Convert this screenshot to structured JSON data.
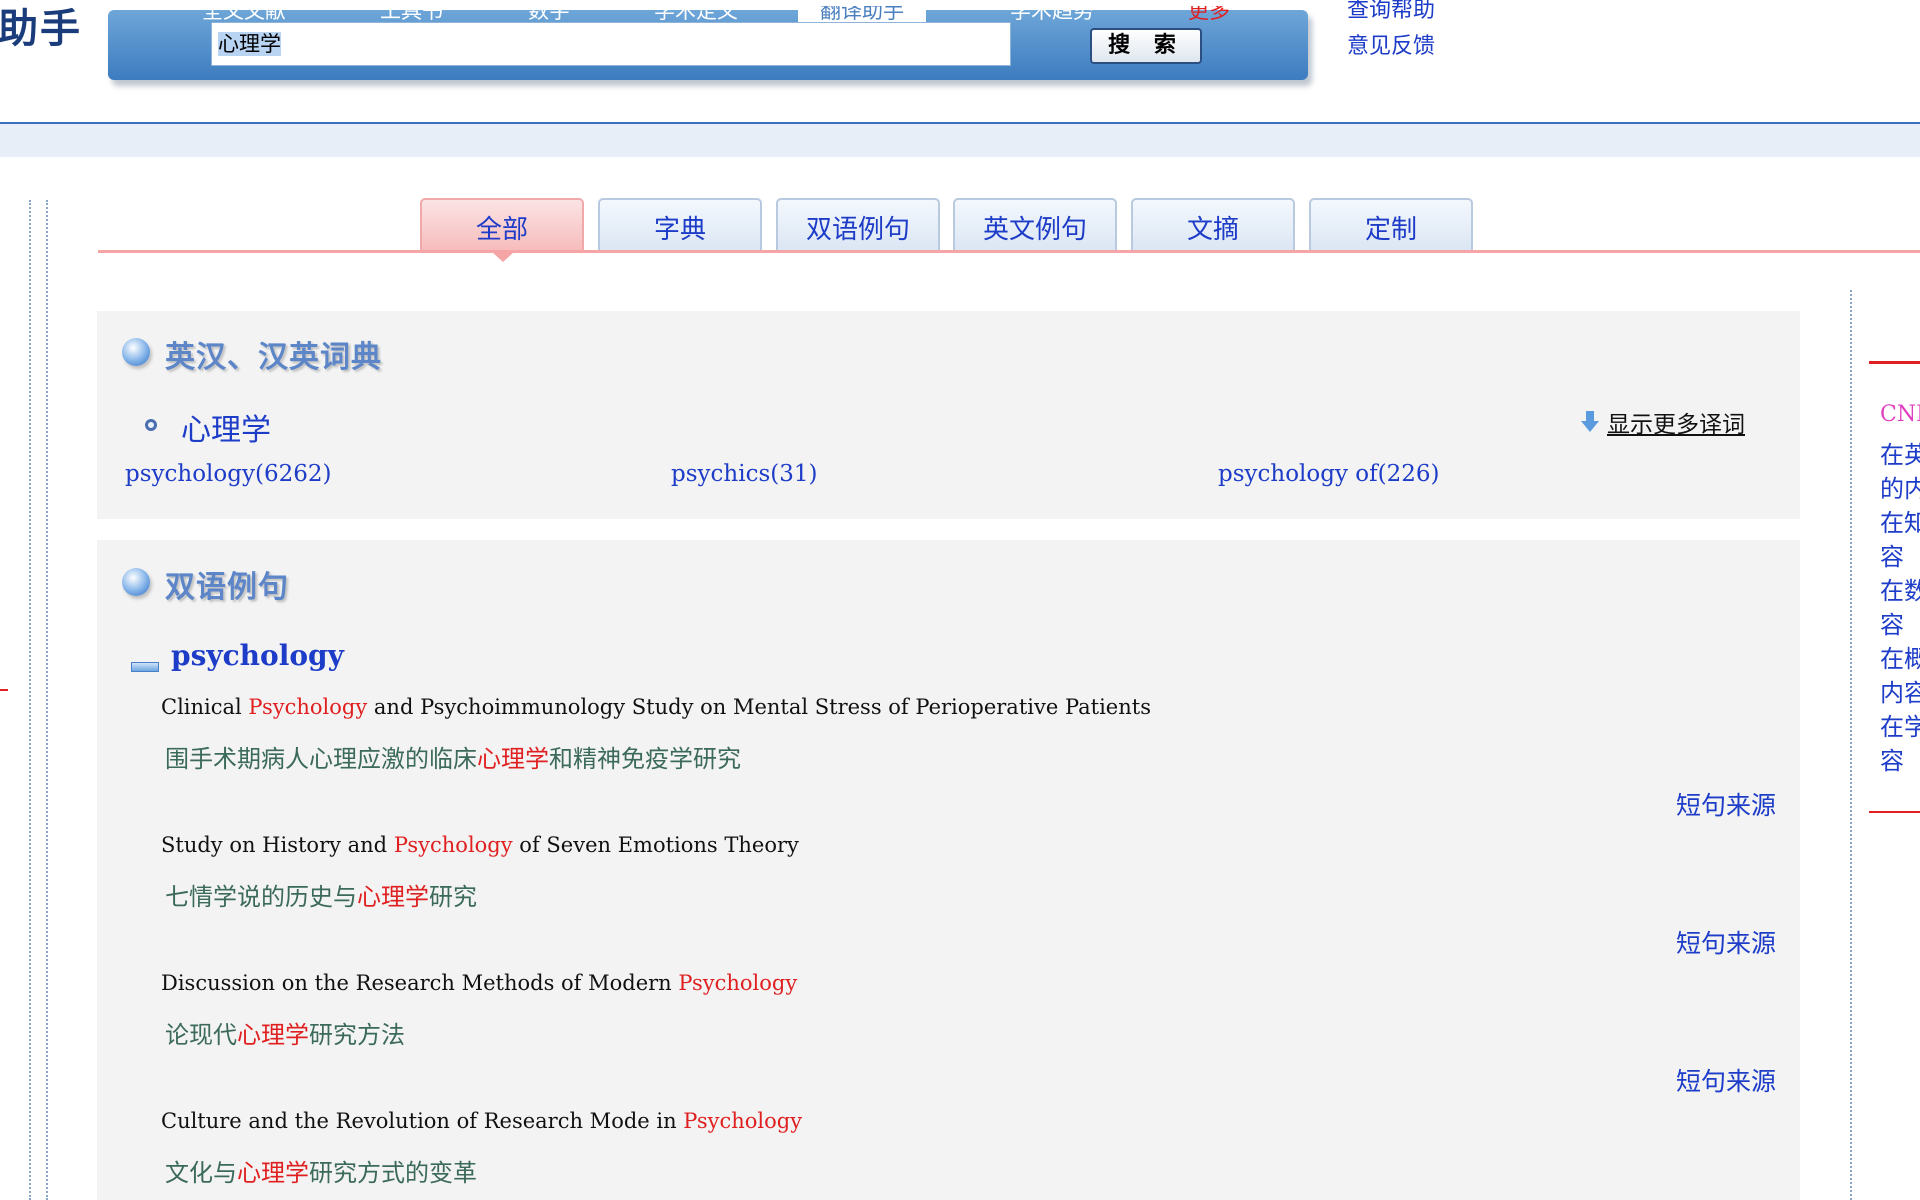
{
  "header": {
    "logo": "助手",
    "top_tabs": [
      "全文文献",
      "工具书",
      "数字",
      "学术定义",
      "翻译助手",
      "学术趋势",
      "更多"
    ],
    "search_value": "心理学",
    "search_button": "搜 索",
    "links": [
      "查询帮助",
      "意见反馈"
    ]
  },
  "tabs": [
    "全部",
    "字典",
    "双语例句",
    "英文例句",
    "文摘",
    "定制"
  ],
  "dictionary": {
    "title": "英汉、汉英词典",
    "term": "心理学",
    "more_link": "显示更多译词",
    "translations": [
      "psychology(6262)",
      "psychics(31)",
      "psychology of(226)"
    ]
  },
  "bilingual": {
    "title": "双语例句",
    "keyword": "psychology",
    "source_label": "短句来源",
    "examples": [
      {
        "en_before": "Clinical ",
        "en_hit": "Psychology",
        "en_after": " and Psychoimmunology Study on Mental Stress of Perioperative Patients",
        "zh_before": "围手术期病人心理应激的临床",
        "zh_hit": "心理学",
        "zh_after": "和精神免疫学研究"
      },
      {
        "en_before": "Study on History and ",
        "en_hit": "Psychology",
        "en_after": " of Seven Emotions Theory",
        "zh_before": "七情学说的历史与",
        "zh_hit": "心理学",
        "zh_after": "研究"
      },
      {
        "en_before": "Discussion on the Research Methods of Modern ",
        "en_hit": "Psychology",
        "en_after": "",
        "zh_before": "论现代",
        "zh_hit": "心理学",
        "zh_after": "研究方法"
      },
      {
        "en_before": "Culture and the Revolution of Research Mode in ",
        "en_hit": "Psychology",
        "en_after": "",
        "zh_before": "文化与",
        "zh_hit": "心理学",
        "zh_after": "研究方式的变革"
      }
    ]
  },
  "sidebar": {
    "title": "CNKI",
    "lines": [
      "在英",
      "的内",
      "在知",
      "容",
      "在数",
      "容",
      "在概",
      "内容",
      "在学",
      "容"
    ]
  }
}
